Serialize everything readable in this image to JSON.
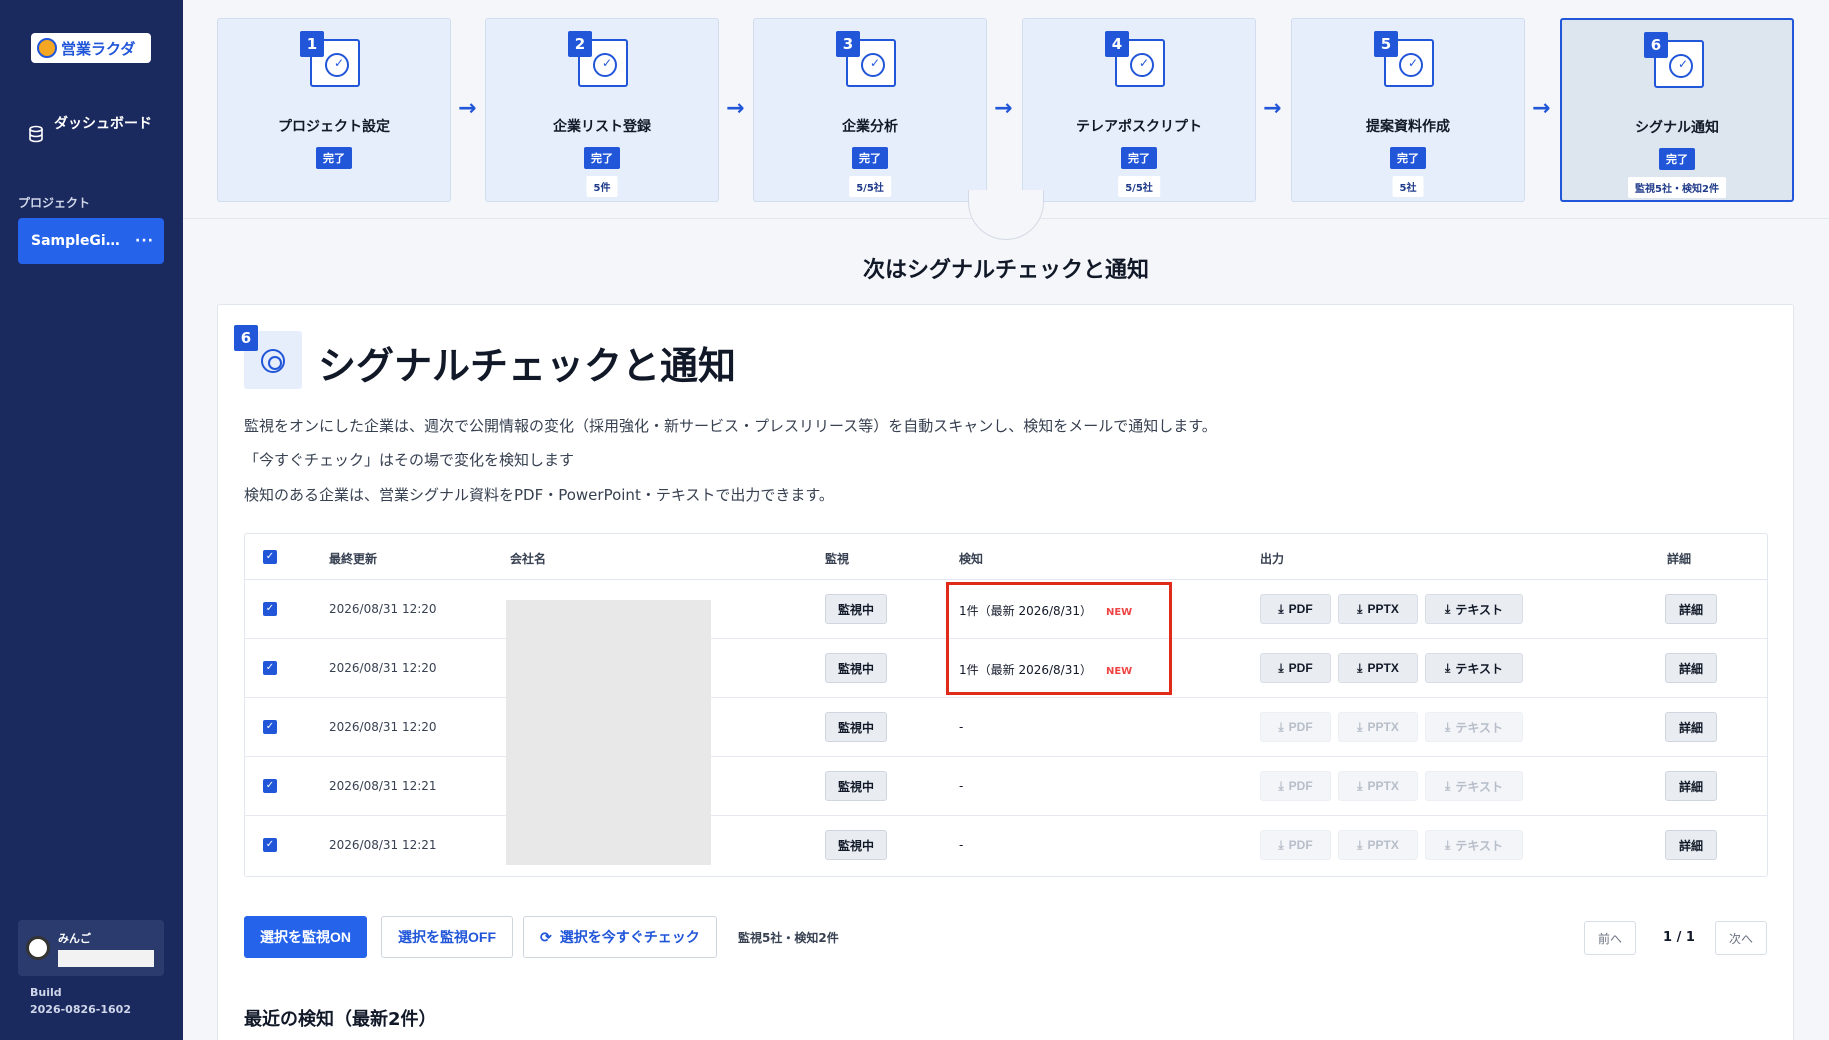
{
  "sidebar": {
    "logo_text": "営業ラクダ",
    "dashboard_label": "ダッシュボード",
    "projects_heading": "プロジェクト",
    "project_name": "SampleGi…",
    "project_more": "···",
    "user_name": "みんご",
    "build_label": "Build",
    "build_number": "2026-0826-1602"
  },
  "steps": [
    {
      "num": "1",
      "title": "プロジェクト設定",
      "badge": "完了",
      "sub": ""
    },
    {
      "num": "2",
      "title": "企業リスト登録",
      "badge": "完了",
      "sub": "5件"
    },
    {
      "num": "3",
      "title": "企業分析",
      "badge": "完了",
      "sub": "5/5社"
    },
    {
      "num": "4",
      "title": "テレアポスクリプト",
      "badge": "完了",
      "sub": "5/5社"
    },
    {
      "num": "5",
      "title": "提案資料作成",
      "badge": "完了",
      "sub": "5社"
    },
    {
      "num": "6",
      "title": "シグナル通知",
      "badge": "完了",
      "sub": "監視5社・検知2件"
    }
  ],
  "next_title": "次はシグナルチェックと通知",
  "panel": {
    "num": "6",
    "title": "シグナルチェックと通知",
    "desc1": "監視をオンにした企業は、週次で公開情報の変化（採用強化・新サービス・プレスリリース等）を自動スキャンし、検知をメールで通知します。",
    "desc2": "「今すぐチェック」はその場で変化を検知します",
    "desc3": "検知のある企業は、営業シグナル資料をPDF・PowerPoint・テキストで出力できます。"
  },
  "table": {
    "headers": {
      "updated": "最終更新",
      "company": "会社名",
      "watch": "監視",
      "detect": "検知",
      "output": "出力",
      "detail": "詳細"
    },
    "rows": [
      {
        "updated": "2026/08/31 12:20",
        "watch": "監視中",
        "detect": "1件（最新 2026/8/31）",
        "new": "NEW",
        "pdf": "PDF",
        "pptx": "PPTX",
        "text": "テキスト",
        "detail": "詳細",
        "enabled": true
      },
      {
        "updated": "2026/08/31 12:20",
        "watch": "監視中",
        "detect": "1件（最新 2026/8/31）",
        "new": "NEW",
        "pdf": "PDF",
        "pptx": "PPTX",
        "text": "テキスト",
        "detail": "詳細",
        "enabled": true
      },
      {
        "updated": "2026/08/31 12:20",
        "watch": "監視中",
        "detect": "-",
        "new": "",
        "pdf": "PDF",
        "pptx": "PPTX",
        "text": "テキスト",
        "detail": "詳細",
        "enabled": false
      },
      {
        "updated": "2026/08/31 12:21",
        "watch": "監視中",
        "detect": "-",
        "new": "",
        "pdf": "PDF",
        "pptx": "PPTX",
        "text": "テキスト",
        "detail": "詳細",
        "enabled": false
      },
      {
        "updated": "2026/08/31 12:21",
        "watch": "監視中",
        "detect": "-",
        "new": "",
        "pdf": "PDF",
        "pptx": "PPTX",
        "text": "テキスト",
        "detail": "詳細",
        "enabled": false
      }
    ]
  },
  "actions": {
    "watch_on": "選択を監視ON",
    "watch_off": "選択を監視OFF",
    "check_now": "選択を今すぐチェック",
    "summary": "監視5社・検知2件"
  },
  "pager": {
    "prev": "前へ",
    "info": "1 / 1",
    "next": "次へ"
  },
  "recent_title": "最近の検知（最新2件）",
  "colors": {
    "primary": "#2563eb",
    "sidebar": "#1b2a5e",
    "highlight": "#e02a1a",
    "new_tag": "#ef4444"
  }
}
